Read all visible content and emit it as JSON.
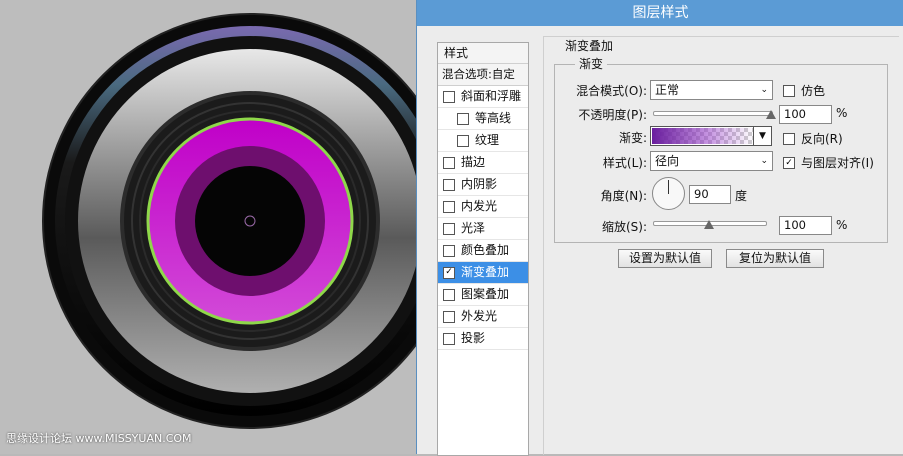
{
  "window": {
    "title": "图层样式"
  },
  "canvas": {
    "watermark": "思缘设计论坛 www.MISSYUAN.COM"
  },
  "style_list": {
    "header": "样式",
    "blend_options": "混合选项:自定",
    "items": [
      {
        "label": "斜面和浮雕",
        "checked": false,
        "indent": false,
        "selected": false
      },
      {
        "label": "等高线",
        "checked": false,
        "indent": true,
        "selected": false
      },
      {
        "label": "纹理",
        "checked": false,
        "indent": true,
        "selected": false
      },
      {
        "label": "描边",
        "checked": false,
        "indent": false,
        "selected": false
      },
      {
        "label": "内阴影",
        "checked": false,
        "indent": false,
        "selected": false
      },
      {
        "label": "内发光",
        "checked": false,
        "indent": false,
        "selected": false
      },
      {
        "label": "光泽",
        "checked": false,
        "indent": false,
        "selected": false
      },
      {
        "label": "颜色叠加",
        "checked": false,
        "indent": false,
        "selected": false
      },
      {
        "label": "渐变叠加",
        "checked": true,
        "indent": false,
        "selected": true
      },
      {
        "label": "图案叠加",
        "checked": false,
        "indent": false,
        "selected": false
      },
      {
        "label": "外发光",
        "checked": false,
        "indent": false,
        "selected": false
      },
      {
        "label": "投影",
        "checked": false,
        "indent": false,
        "selected": false
      }
    ]
  },
  "gradient_overlay": {
    "section_title": "渐变叠加",
    "structure_title": "渐变",
    "blend_mode_label": "混合模式(O):",
    "blend_mode_value": "正常",
    "dither_label": "仿色",
    "dither_checked": false,
    "opacity_label": "不透明度(P):",
    "opacity_value": "100",
    "opacity_unit": "%",
    "gradient_label": "渐变:",
    "reverse_label": "反向(R)",
    "reverse_checked": false,
    "style_label": "样式(L):",
    "style_value": "径向",
    "align_label": "与图层对齐(I)",
    "align_checked": true,
    "angle_label": "角度(N):",
    "angle_value": "90",
    "angle_unit": "度",
    "scale_label": "缩放(S):",
    "scale_value": "100",
    "scale_unit": "%",
    "opacity_fraction": 1.0,
    "scale_fraction": 0.5,
    "gradient_colors": [
      "#6a1e9e",
      "#ffffff"
    ]
  },
  "buttons": {
    "make_default": "设置为默认值",
    "reset_default": "复位为默认值"
  },
  "icons": {
    "checkmark": "✓",
    "dropdown": "▼"
  }
}
